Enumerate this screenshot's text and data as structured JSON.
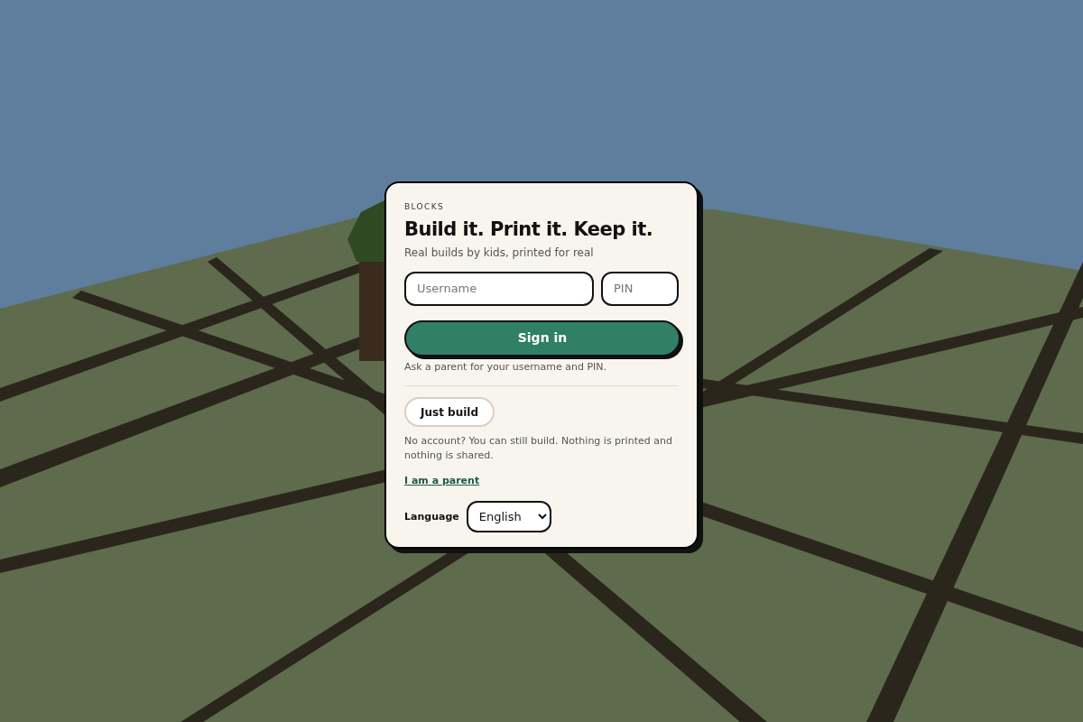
{
  "brand": "BLOCKS",
  "title": "Build it. Print it. Keep it.",
  "subtitle": "Real builds by kids, printed for real",
  "username": {
    "placeholder": "Username"
  },
  "pin": {
    "placeholder": "PIN"
  },
  "sign_in_button": "Sign in",
  "help_text": "Ask a parent for your username and PIN.",
  "guest_button": "Just build",
  "guest_note": "No account? You can still build. Nothing is printed and nothing is shared.",
  "parent_link": "I am a parent",
  "language": {
    "label": "Language",
    "value": "English"
  }
}
